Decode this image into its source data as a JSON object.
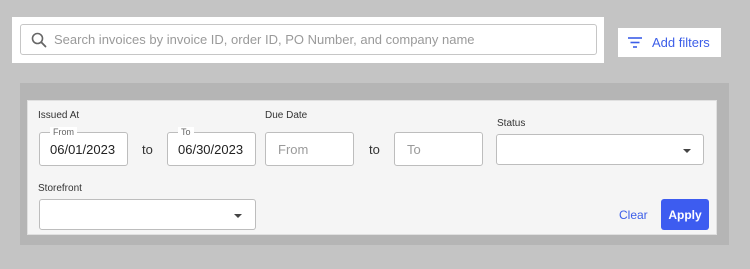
{
  "search": {
    "placeholder": "Search invoices by invoice ID, order ID, PO Number, and company name",
    "icon": "search-icon"
  },
  "toolbar": {
    "add_filters_label": "Add filters",
    "icon": "filter-lines-icon"
  },
  "filters": {
    "issued_at": {
      "label": "Issued At",
      "from_label": "From",
      "from_value": "06/01/2023",
      "separator": "to",
      "to_label": "To",
      "to_value": "06/30/2023"
    },
    "due_date": {
      "label": "Due Date",
      "from_placeholder": "From",
      "separator": "to",
      "to_placeholder": "To"
    },
    "status": {
      "label": "Status",
      "selected": ""
    },
    "storefront": {
      "label": "Storefront",
      "selected": ""
    }
  },
  "actions": {
    "clear_label": "Clear",
    "apply_label": "Apply"
  },
  "colors": {
    "accent": "#3d5cf0",
    "link": "#3c5ee8",
    "background": "#c4c4c4",
    "panel": "#f5f5f5"
  }
}
